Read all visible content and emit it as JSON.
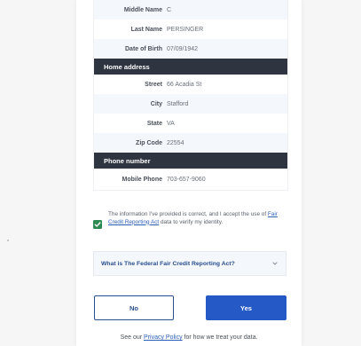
{
  "personal": {
    "rows": [
      {
        "label": "Middle Name",
        "value": "C"
      },
      {
        "label": "Last Name",
        "value": "PERSINGER"
      },
      {
        "label": "Date of Birth",
        "value": "07/09/1942"
      }
    ]
  },
  "home_address": {
    "heading": "Home address",
    "rows": [
      {
        "label": "Street",
        "value": "66 Acadia St"
      },
      {
        "label": "City",
        "value": "Stafford"
      },
      {
        "label": "State",
        "value": "VA"
      },
      {
        "label": "Zip Code",
        "value": "22554"
      }
    ]
  },
  "phone": {
    "heading": "Phone number",
    "rows": [
      {
        "label": "Mobile Phone",
        "value": "703-657-9060"
      }
    ]
  },
  "consent": {
    "checked": true,
    "text_before": "The information I've provided is correct, and I accept the use of ",
    "link_text": "Fair Credit Reporting Act",
    "text_after": " data to verify my identity."
  },
  "faq": {
    "question": "What is The Federal Fair Credit Reporting Act?",
    "icon": "chevron-down-icon"
  },
  "buttons": {
    "no_label": "No",
    "yes_label": "Yes"
  },
  "privacy": {
    "text_before": "See our ",
    "link_text": "Privacy Policy",
    "text_after": " for how we treat your data."
  },
  "colors": {
    "section_header": "#2e3440",
    "primary": "#2459c6",
    "checkbox": "#2e8a52",
    "link": "#2a5fb8"
  }
}
